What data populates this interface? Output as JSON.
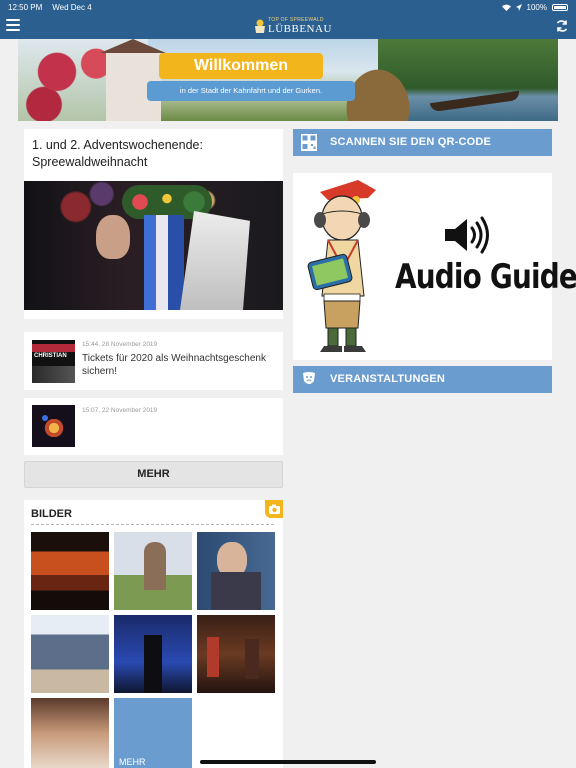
{
  "status_bar": {
    "time": "12:50 PM",
    "date": "Wed Dec 4",
    "battery": "100%"
  },
  "header": {
    "logo_line1": "TOP OF SPREEWALD",
    "logo_line2": "LÜBBENAU"
  },
  "banner": {
    "welcome": "Willkommen",
    "subtitle": "in der Stadt der Kahnfahrt und der Gurken."
  },
  "news": {
    "featured_title": "1. und 2. Adventswochenende: Spreewaldweihnacht",
    "items": [
      {
        "date": "15:44, 28 November 2019",
        "title": "Tickets für 2020 als Weihnachtsgeschenk sichern!",
        "thumb_text": "CHRISTIAN"
      },
      {
        "date": "15:07, 22 November 2019",
        "title": ""
      }
    ],
    "more_label": "MEHR"
  },
  "gallery": {
    "title": "BILDER",
    "more_label": "MEHR"
  },
  "sidebar": {
    "qr_label": "SCANNEN SIE DEN QR-CODE",
    "audio_guide_label": "Audio Guide",
    "events_label": "VERANSTALTUNGEN"
  },
  "colors": {
    "header": "#2b5f8f",
    "accent_blue": "#6a9cd0",
    "accent_yellow": "#f2b51c"
  },
  "icons": [
    "menu-icon",
    "refresh-icon",
    "qr-code-icon",
    "speaker-icon",
    "theater-mask-icon",
    "camera-icon"
  ]
}
